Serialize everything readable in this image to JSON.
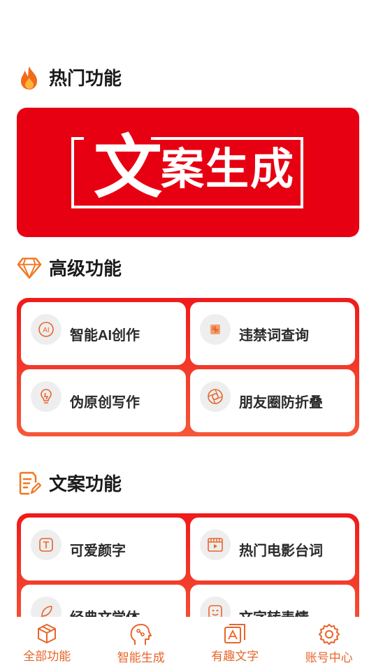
{
  "hot": {
    "title": "热门功能",
    "icon": "flame-icon"
  },
  "banner": {
    "title_main": "文",
    "title_rest": "案生成",
    "bg_color": "#e60012"
  },
  "advanced": {
    "title": "高级功能",
    "icon": "diamond-icon",
    "items": [
      {
        "label": "智能AI创作",
        "icon": "ai-icon"
      },
      {
        "label": "违禁词查询",
        "icon": "forbidden-word-icon"
      },
      {
        "label": "伪原创写作",
        "icon": "lightbulb-icon"
      },
      {
        "label": "朋友圈防折叠",
        "icon": "aperture-icon"
      }
    ]
  },
  "copywriting": {
    "title": "文案功能",
    "icon": "document-edit-icon",
    "items": [
      {
        "label": "可爱颜字",
        "icon": "text-t-icon"
      },
      {
        "label": "热门电影台词",
        "icon": "film-icon"
      },
      {
        "label": "经典文学体",
        "icon": "feather-icon"
      },
      {
        "label": "文字转表情",
        "icon": "emoji-icon"
      }
    ]
  },
  "tabbar": {
    "items": [
      {
        "label": "全部功能",
        "icon": "cube-icon"
      },
      {
        "label": "智能生成",
        "icon": "brain-head-icon"
      },
      {
        "label": "有趣文字",
        "icon": "text-frame-icon"
      },
      {
        "label": "账号中心",
        "icon": "gear-icon"
      }
    ]
  },
  "colors": {
    "accent": "#e8652a",
    "panel_top": "#f01a1a",
    "panel_bottom": "#f5583a"
  }
}
